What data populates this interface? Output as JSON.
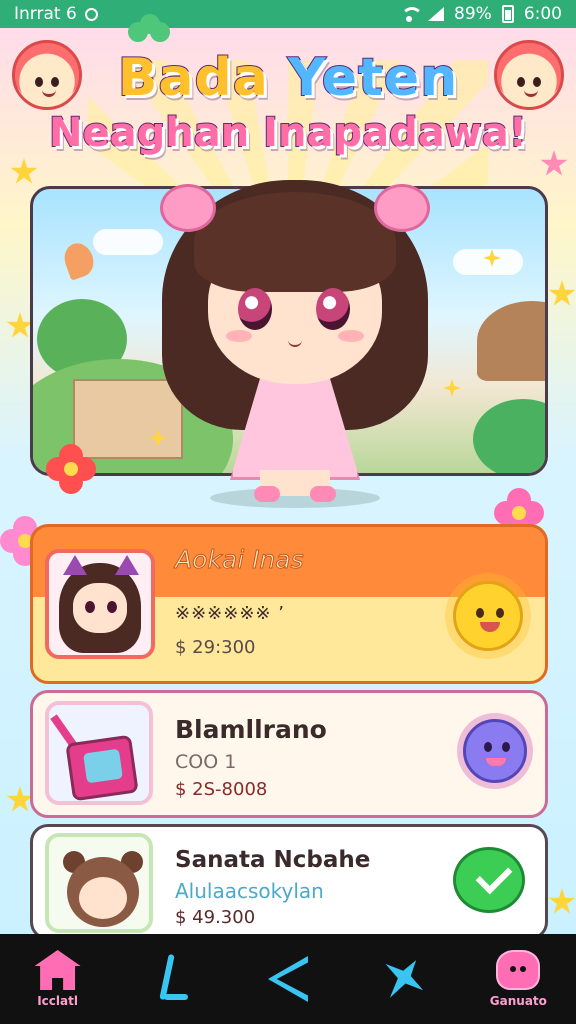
{
  "status_bar": {
    "carrier": "Inrrat 6",
    "battery": "89%",
    "time": "6:00",
    "icons": [
      "record-icon",
      "wifi-icon",
      "signal-icon",
      "battery-icon"
    ]
  },
  "header": {
    "title_word_1": "Bada",
    "title_word_2": "Yeten",
    "subtitle": "Neaghan Inapadawa!"
  },
  "hero": {
    "image": "chibi-girl-illustration"
  },
  "cards": [
    {
      "title": "Aokai Inas",
      "subtitle": "※※※※※※ ’",
      "price": "$ 29:300",
      "thumb": "catgirl-avatar",
      "icon": "sun-icon"
    },
    {
      "title": "Blamllrano",
      "subtitle": "COO 1",
      "price": "$ 2S-8008",
      "thumb": "gift-box-avatar",
      "icon": "germ-icon"
    },
    {
      "title": "Sanata Ncbahe",
      "subtitle": "Alulaacsokylan",
      "price": "$ 49.300",
      "thumb": "bear-avatar",
      "icon": "check-icon"
    }
  ],
  "bottom_nav": {
    "items": [
      {
        "label": "Icclatl",
        "icon": "home-icon"
      },
      {
        "label": "",
        "icon": "lightning-icon"
      },
      {
        "label": "",
        "icon": "triangle-icon"
      },
      {
        "label": "",
        "icon": "plane-icon"
      },
      {
        "label": "Ganuato",
        "icon": "profile-icon"
      }
    ]
  },
  "colors": {
    "status_bar": "#2fae77",
    "title_yellow": "#ffc02e",
    "title_blue": "#53b7ff",
    "subtitle_pink": "#ff6ea6",
    "card_orange": "#ff8b3a",
    "nav_bg": "#111111",
    "nav_pink": "#ff6eb5",
    "nav_blue": "#39c4f2"
  }
}
